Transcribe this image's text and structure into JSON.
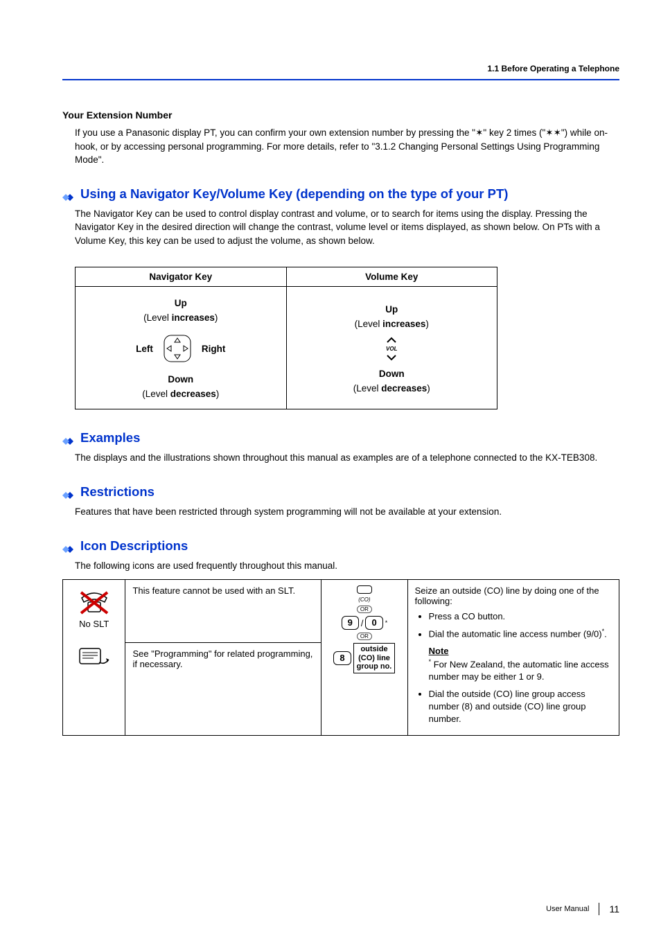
{
  "header": {
    "breadcrumb": "1.1 Before Operating a Telephone"
  },
  "ext": {
    "heading": "Your Extension Number",
    "para": "If you use a Panasonic display PT, you can confirm your own extension number by pressing the \"✶\" key 2 times (\"✶✶\") while on-hook, or by accessing personal programming. For more details, refer to \"3.1.2 Changing Personal Settings Using Programming Mode\"."
  },
  "nav": {
    "heading": "Using a Navigator Key/Volume Key (depending on the type of your PT)",
    "para": "The Navigator Key can be used to control display contrast and volume, or to search for items using the display. Pressing the Navigator Key in the desired direction will change the contrast, volume level or items displayed, as shown below. On PTs with a Volume Key, this key can be used to adjust the volume, as shown below.",
    "colA": "Navigator Key",
    "colB": "Volume Key",
    "up": "Up",
    "down": "Down",
    "left": "Left",
    "right": "Right",
    "inc_a": "(Level ",
    "inc_b": "increases",
    "inc_c": ")",
    "dec_a": "(Level ",
    "dec_b": "decreases",
    "dec_c": ")",
    "vol": "VOL"
  },
  "ex": {
    "heading": "Examples",
    "para": "The displays and the illustrations shown throughout this manual as examples are of a telephone connected to the KX-TEB308."
  },
  "res": {
    "heading": "Restrictions",
    "para": "Features that have been restricted through system programming will not be available at your extension."
  },
  "icons": {
    "heading": "Icon Descriptions",
    "para": "The following icons are used frequently throughout this manual.",
    "row1_desc": "This feature cannot be used with an SLT.",
    "no_slt": "No SLT",
    "row2_desc": "See \"Programming\" for related programming, if necessary.",
    "co_label": "(CO)",
    "or": "OR",
    "key9": "9",
    "slash": "/",
    "key0": "0",
    "star_sup": "*",
    "key8": "8",
    "outside_box": "outside\n(CO) line\ngroup no.",
    "right_intro": "Seize an outside (CO) line by doing one of the following:",
    "b1": "Press a CO button.",
    "b2_a": "Dial the automatic line access number (9/0)",
    "b2_b": ".",
    "note": "Note",
    "note_body": " For New Zealand, the automatic line access number may be either 1 or 9.",
    "b3": "Dial the outside (CO) line group access number (8) and outside (CO) line group number."
  },
  "footer": {
    "label": "User Manual",
    "page": "11"
  }
}
